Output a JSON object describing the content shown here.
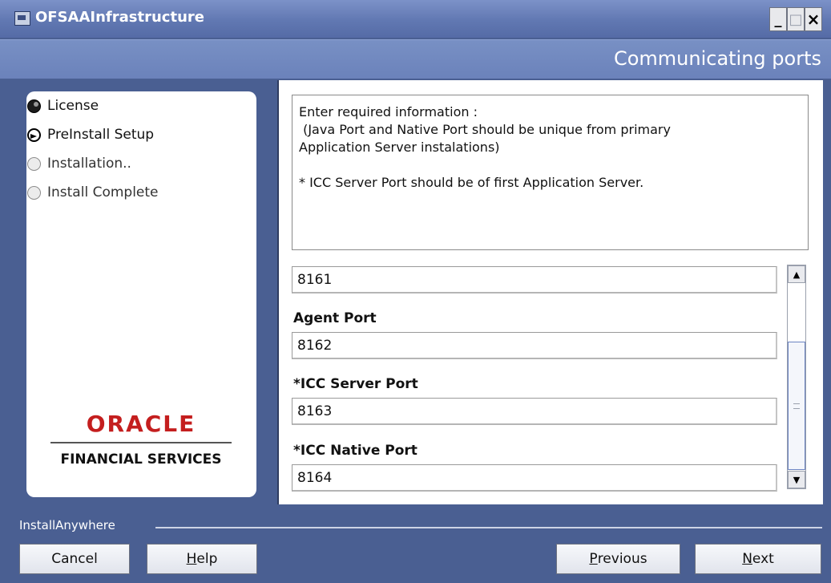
{
  "window": {
    "title": "OFSAAInfrastructure",
    "minimize_glyph": "_",
    "maximize_glyph": "□",
    "close_glyph": "×"
  },
  "header": {
    "title": "Communicating ports"
  },
  "steps": [
    {
      "label": "License",
      "state": "done"
    },
    {
      "label": "PreInstall Setup",
      "state": "current"
    },
    {
      "label": "Installation..",
      "state": "pending"
    },
    {
      "label": "Install Complete",
      "state": "pending"
    }
  ],
  "logo": {
    "brand": "ORACLE",
    "subtitle": "FINANCIAL SERVICES"
  },
  "info": {
    "line1": "Enter  required information :",
    "line2": " (Java Port and Native Port should be unique from primary",
    "line3": "Application Server instalations)",
    "line4": "* ICC Server Port should be of  first Application Server."
  },
  "form": {
    "partial_value": "8161",
    "fields": [
      {
        "label": "Agent Port",
        "value": "8162"
      },
      {
        "label": "*ICC Server Port",
        "value": "8163"
      },
      {
        "label": "*ICC Native Port",
        "value": "8164"
      }
    ]
  },
  "footer": {
    "brand": "InstallAnywhere",
    "cancel": "Cancel",
    "help_mnemonic": "H",
    "help_rest": "elp",
    "previous_mnemonic": "P",
    "previous_rest": "revious",
    "next_mnemonic": "N",
    "next_rest": "ext"
  },
  "colors": {
    "background": "#4a5f92",
    "titlebar": "#6178b2",
    "oracle_red": "#c41e1e"
  },
  "icons": [
    "app-icon",
    "step-done-icon",
    "step-current-icon",
    "step-pending-icon",
    "scroll-up-icon",
    "scroll-down-icon"
  ]
}
